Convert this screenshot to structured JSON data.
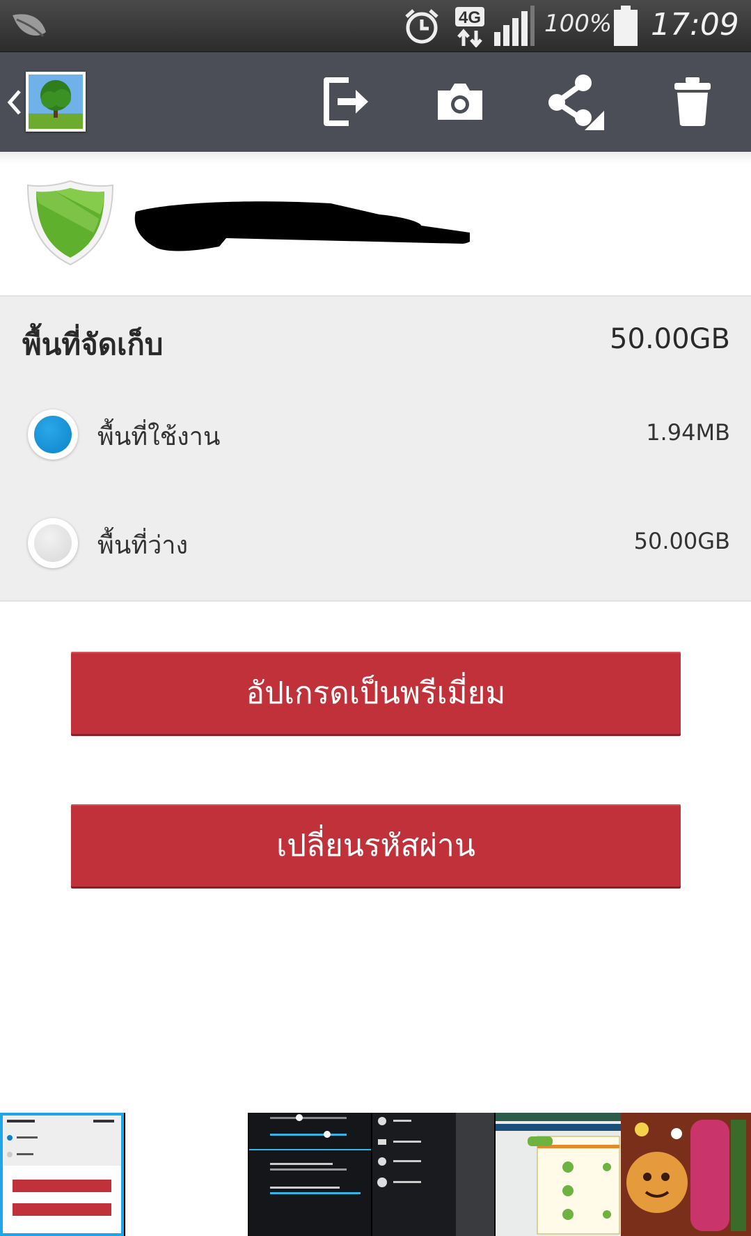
{
  "status_bar": {
    "network": "4G",
    "battery_percent": "100%",
    "time": "17:09"
  },
  "action_bar": {
    "icons": [
      "back-chevron-icon",
      "gallery-thumbnail-icon",
      "export-icon",
      "camera-icon",
      "share-icon",
      "trash-icon"
    ]
  },
  "storage": {
    "title": "พื้นที่จัดเก็บ",
    "total": "50.00GB",
    "used_label": "พื้นที่ใช้งาน",
    "used_value": "1.94MB",
    "free_label": "พื้นที่ว่าง",
    "free_value": "50.00GB"
  },
  "buttons": {
    "upgrade": "อัปเกรดเป็นพรีเมี่ยม",
    "change_password": "เปลี่ยนรหัสผ่าน"
  },
  "colors": {
    "action_bar": "#4b4e56",
    "button_red": "#c0313a",
    "accent_blue": "#0a84c8",
    "shield_green": "#5fb02c",
    "storage_bg": "#eeeeee"
  }
}
